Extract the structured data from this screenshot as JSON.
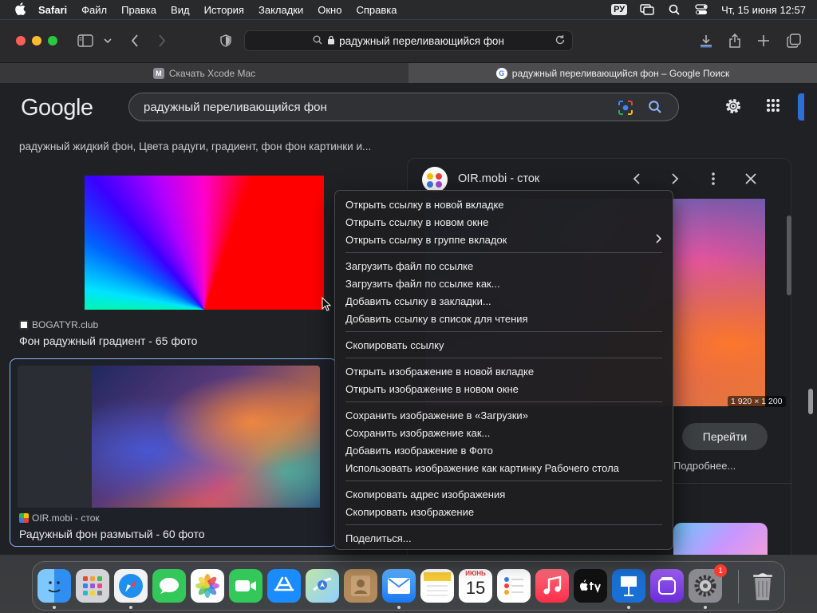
{
  "menubar": {
    "app_name": "Safari",
    "items": [
      "Файл",
      "Правка",
      "Вид",
      "История",
      "Закладки",
      "Окно",
      "Справка"
    ],
    "input_source": "РУ",
    "clock": "Чт, 15 июня  12:57"
  },
  "safari": {
    "address": "радужный переливающийся фон",
    "tabs": [
      {
        "label": "Скачать Xcode Mac",
        "favicon": "M",
        "active": false
      },
      {
        "label": "радужный переливающийся фон – Google Поиск",
        "favicon": "G",
        "active": true
      }
    ]
  },
  "google": {
    "logo": "Google",
    "query": "радужный переливающийся фон",
    "truncated_caption": "радужный жидкий фон, Цвета радуги, градиент, фон фон картинки и...",
    "results": [
      {
        "source": "BOGATYR.club",
        "title": "Фон радужный градиент - 65 фото"
      },
      {
        "source": "OIR.mobi - сток",
        "title": "Радужный фон размытый - 60 фото"
      }
    ]
  },
  "preview_panel": {
    "source": "OIR.mobi - сток",
    "dimensions": "1 920 × 1 200",
    "goto_label": "Перейти",
    "more_label": "Подробнее..."
  },
  "context_menu": {
    "groups": [
      [
        "Открыть ссылку в новой вкладке",
        "Открыть ссылку в новом окне",
        "Открыть ссылку в группе вкладок"
      ],
      [
        "Загрузить файл по ссылке",
        "Загрузить файл по ссылке как...",
        "Добавить ссылку в закладки...",
        "Добавить ссылку в список для чтения"
      ],
      [
        "Скопировать ссылку"
      ],
      [
        "Открыть изображение в новой вкладке",
        "Открыть изображение в новом окне"
      ],
      [
        "Сохранить изображение в «Загрузки»",
        "Сохранить изображение как...",
        "Добавить изображение в Фото",
        "Использовать изображение как картинку Рабочего стола"
      ],
      [
        "Скопировать адрес изображения",
        "Скопировать изображение"
      ],
      [
        "Поделиться..."
      ]
    ]
  },
  "dock": {
    "apps": [
      "finder-icon",
      "launchpad-icon",
      "safari-icon",
      "messages-icon",
      "photos-icon",
      "facetime-icon",
      "app-store-icon",
      "maps-icon",
      "contacts-icon",
      "mail-icon",
      "notes-icon",
      "calendar-icon",
      "reminders-icon",
      "music-icon",
      "apple-tv-icon",
      "keynote-icon",
      "podcasts-icon",
      "system-settings-icon",
      "trash-icon"
    ],
    "calendar_month": "ИЮНЬ",
    "calendar_day": "15",
    "settings_badge": "1"
  },
  "colors": {
    "accent_blue": "#8ab4f8",
    "menu_bg": "#1e1e20",
    "page_bg": "#202124"
  }
}
